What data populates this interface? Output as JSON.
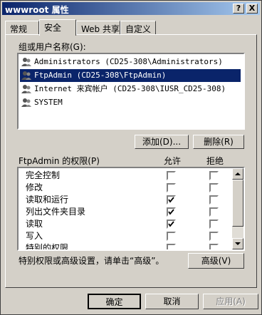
{
  "window": {
    "title": "wwwroot 属性",
    "help_label": "?",
    "close_label": "X"
  },
  "tabs": [
    "常规",
    "安全",
    "Web 共享",
    "自定义"
  ],
  "active_tab": "安全",
  "users": {
    "label": "组或用户名称(G):",
    "items": [
      {
        "name": "Administrators (CD25-308\\Administrators)",
        "selected": false
      },
      {
        "name": "FtpAdmin (CD25-308\\FtpAdmin)",
        "selected": true
      },
      {
        "name": "Internet 来宾帐户 (CD25-308\\IUSR_CD25-308)",
        "selected": false
      },
      {
        "name": "SYSTEM",
        "selected": false
      }
    ],
    "add_label": "添加(D)...",
    "remove_label": "删除(R)"
  },
  "permissions": {
    "label": "FtpAdmin 的权限(P)",
    "allow_header": "允许",
    "deny_header": "拒绝",
    "items": [
      {
        "name": "完全控制",
        "allow": false,
        "deny": false
      },
      {
        "name": "修改",
        "allow": false,
        "deny": false
      },
      {
        "name": "读取和运行",
        "allow": true,
        "deny": false
      },
      {
        "name": "列出文件夹目录",
        "allow": true,
        "deny": false
      },
      {
        "name": "读取",
        "allow": true,
        "deny": false
      },
      {
        "name": "写入",
        "allow": false,
        "deny": false
      },
      {
        "name": "特别的权限",
        "allow": false,
        "deny": false
      }
    ]
  },
  "advanced": {
    "text": "特别权限或高级设置，请单击“高级”。",
    "button_label": "高级(V)"
  },
  "footer": {
    "ok_label": "确定",
    "cancel_label": "取消",
    "apply_label": "应用(A)"
  },
  "colors": {
    "face": "#d4d0c8",
    "title_start": "#0a246a",
    "title_end": "#a6caf0",
    "selection": "#0a246a"
  }
}
